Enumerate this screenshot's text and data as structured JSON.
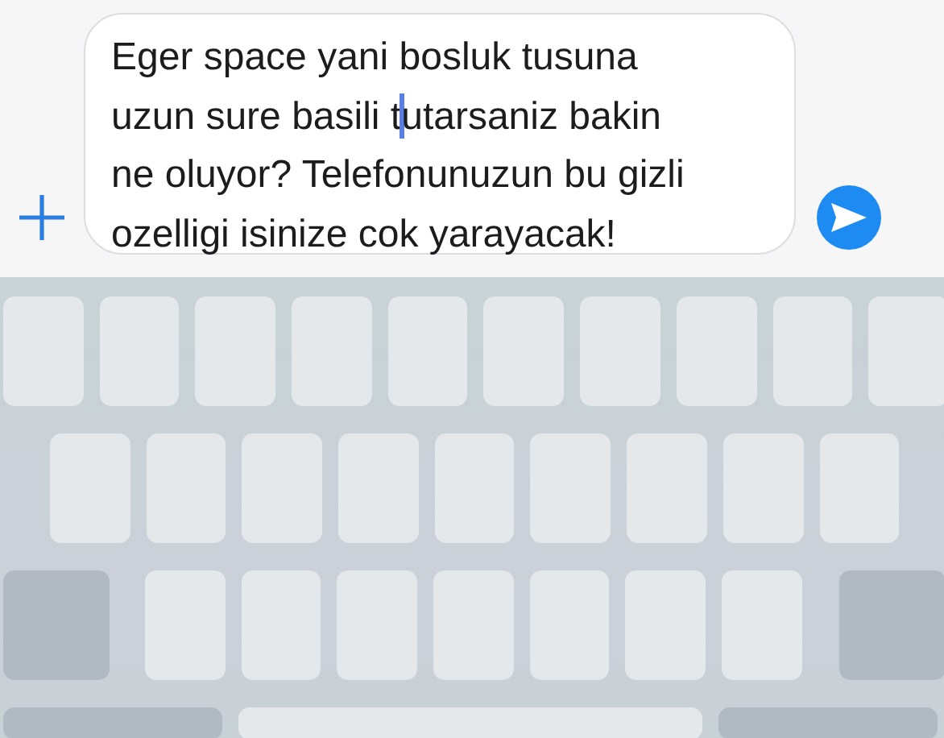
{
  "composer": {
    "lines": [
      [
        "Eger space yani bosluk tusuna"
      ],
      [
        "uzun sure basili t",
        "utarsaniz bakin"
      ],
      [
        "ne oluyor? Telefonunuzun bu gizli"
      ],
      [
        "ozelligi isinize cok yarayacak!"
      ]
    ]
  },
  "keyboard": {
    "rows": [
      {
        "keys": [
          {
            "kind": "letter"
          },
          {
            "kind": "letter"
          },
          {
            "kind": "letter"
          },
          {
            "kind": "letter"
          },
          {
            "kind": "letter"
          },
          {
            "kind": "letter"
          },
          {
            "kind": "letter"
          },
          {
            "kind": "letter"
          },
          {
            "kind": "letter"
          },
          {
            "kind": "letter"
          }
        ]
      },
      {
        "keys": [
          {
            "kind": "letter"
          },
          {
            "kind": "letter"
          },
          {
            "kind": "letter"
          },
          {
            "kind": "letter"
          },
          {
            "kind": "letter"
          },
          {
            "kind": "letter"
          },
          {
            "kind": "letter"
          },
          {
            "kind": "letter"
          },
          {
            "kind": "letter"
          }
        ]
      },
      {
        "keys": [
          {
            "kind": "function"
          },
          {
            "kind": "letter"
          },
          {
            "kind": "letter"
          },
          {
            "kind": "letter"
          },
          {
            "kind": "letter"
          },
          {
            "kind": "letter"
          },
          {
            "kind": "letter"
          },
          {
            "kind": "letter"
          },
          {
            "kind": "function"
          }
        ]
      },
      {
        "keys": [
          {
            "kind": "function"
          },
          {
            "kind": "space"
          },
          {
            "kind": "function"
          }
        ]
      }
    ]
  }
}
